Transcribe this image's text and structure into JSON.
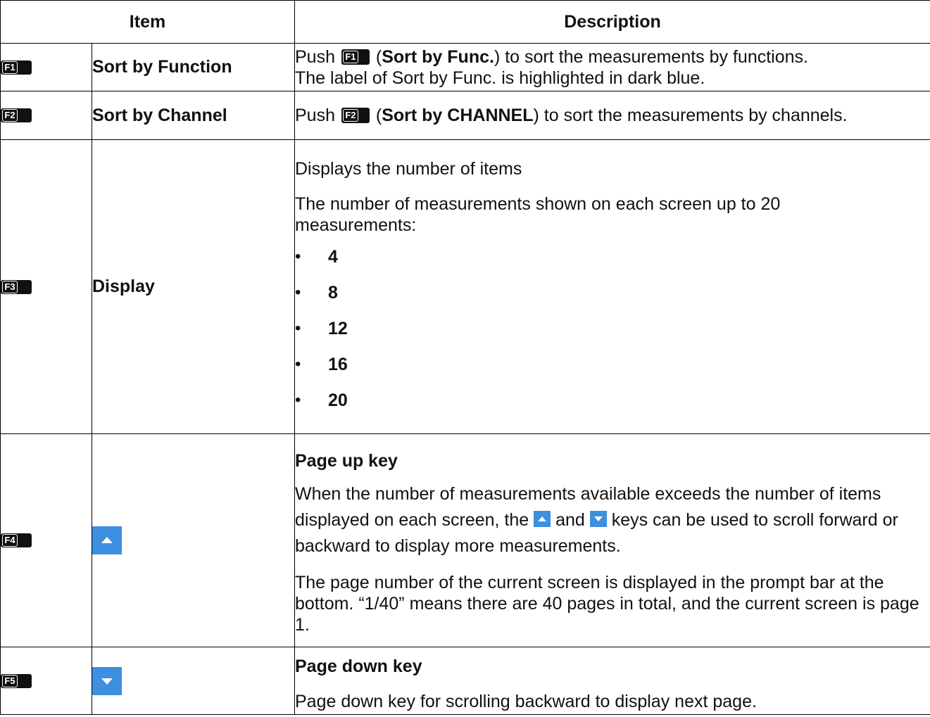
{
  "header": {
    "item": "Item",
    "description": "Description"
  },
  "rows": [
    {
      "key": "F1",
      "item": "Sort by Function",
      "desc_push": "Push",
      "desc_bold": "Sort by Func.",
      "desc_rest": ") to sort the measurements by functions.",
      "desc_line2": "The label of Sort by Func. is highlighted in dark blue."
    },
    {
      "key": "F2",
      "item": "Sort by Channel",
      "desc_push": "Push",
      "desc_bold": "Sort by CHANNEL",
      "desc_rest": ") to sort the measurements by channels."
    },
    {
      "key": "F3",
      "item": "Display",
      "para1": "Displays the number of items",
      "para2": "The number of measurements shown on each screen up to 20 measurements:",
      "options": [
        "4",
        "8",
        "12",
        "16",
        "20"
      ]
    },
    {
      "key": "F4",
      "icon": "arrow-up-icon",
      "title": "Page up key",
      "para1_a": "When the number of measurements available exceeds the number of items displayed on each screen, the",
      "para1_and": "and",
      "para1_b": "keys can be used to scroll forward or backward to display more measurements.",
      "para2": "The page number of the current screen is displayed in the prompt bar at the bottom. “1/40” means there are 40 pages in total, and the current screen is page 1."
    },
    {
      "key": "F5",
      "icon": "arrow-down-icon",
      "title": "Page down key",
      "para1": "Page down key for scrolling backward to display next page."
    }
  ],
  "colors": {
    "arrow_button": "#3d8fe0",
    "key_badge": "#111111"
  }
}
